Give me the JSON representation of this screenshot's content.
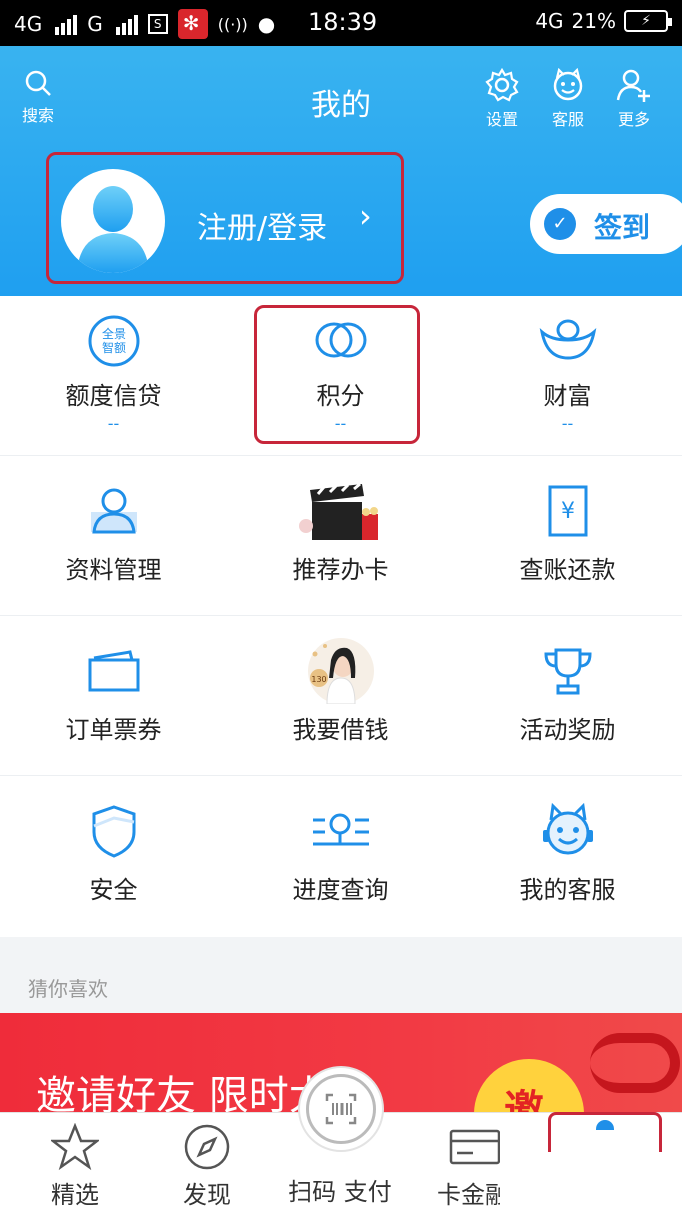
{
  "status_bar": {
    "network1": "4G",
    "network2": "G",
    "s_icon": "S",
    "time": "18:39",
    "network3": "4G",
    "battery": "21%"
  },
  "header": {
    "search": "搜索",
    "title": "我的",
    "settings": "设置",
    "service": "客服",
    "more": "更多",
    "login": "注册/登录",
    "login_arrow": "›",
    "sign_in": "签到"
  },
  "grid": {
    "row1": [
      {
        "label": "额度信贷",
        "sub": "--",
        "icon": "quota-credit-icon"
      },
      {
        "label": "积分",
        "sub": "--",
        "icon": "points-icon"
      },
      {
        "label": "财富",
        "sub": "--",
        "icon": "wealth-icon"
      }
    ],
    "row2": [
      {
        "label": "资料管理",
        "icon": "profile-icon"
      },
      {
        "label": "推荐办卡",
        "icon": "recommend-card-icon"
      },
      {
        "label": "查账还款",
        "icon": "bill-repay-icon"
      }
    ],
    "row3": [
      {
        "label": "订单票券",
        "icon": "order-ticket-icon"
      },
      {
        "label": "我要借钱",
        "icon": "borrow-money-icon"
      },
      {
        "label": "活动奖励",
        "icon": "trophy-icon"
      }
    ],
    "row4": [
      {
        "label": "安全",
        "icon": "shield-icon"
      },
      {
        "label": "进度查询",
        "icon": "progress-search-icon"
      },
      {
        "label": "我的客服",
        "icon": "customer-service-icon"
      }
    ],
    "quota_badge_line1": "全景",
    "quota_badge_line2": "智额",
    "yen": "¥",
    "coin_label": "130"
  },
  "guess": "猜你喜欢",
  "banner": {
    "text": "邀请好友 限时大奖",
    "coin": "邀"
  },
  "tabbar": {
    "featured": "精选",
    "discover": "发现",
    "scan_pay": "扫码 支付",
    "card_finance": "卡金融"
  },
  "colors": {
    "header_blue": "#1f9ff0",
    "accent_blue": "#1f8fe8",
    "highlight_red": "#c7263a",
    "banner_red": "#ef2c3a"
  }
}
